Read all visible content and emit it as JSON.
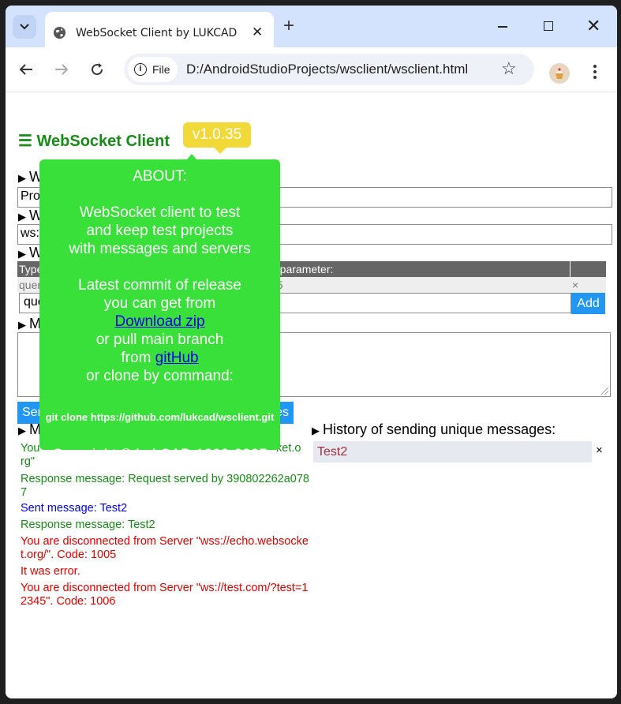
{
  "browser": {
    "tab_title": "WebSocket Client by LUKCAD",
    "chip_label": "File",
    "url": "D:/AndroidStudioProjects/wsclient/wsclient.html"
  },
  "app": {
    "menu_glyph": "☰",
    "title": "WebSocket Client",
    "version": "v1.0.35"
  },
  "sections": {
    "projects_label": "W",
    "project_value": "Pro",
    "servers_label": "W",
    "server_value": "ws:",
    "params_label": "W",
    "message_label": "M",
    "log_label": "M"
  },
  "params": {
    "head_type": "Type",
    "head_value": "e parameter:",
    "row_type": "quer",
    "row_value": "45",
    "row_remove": "×",
    "input_value": "que",
    "add_label": "Add"
  },
  "send": {
    "left_label": "Sen",
    "right_label": "es"
  },
  "log": [
    {
      "kind": "resp",
      "text": "You"
    },
    {
      "kind": "resp",
      "text": "rg\""
    },
    {
      "kind": "resp",
      "text": "Response message: Request served by 390802262a0787"
    },
    {
      "kind": "sent",
      "text": "Sent message: Test2"
    },
    {
      "kind": "resp",
      "text": "Response message: Test2"
    },
    {
      "kind": "err",
      "text": "You are disconnected from Server \"wss://echo.websocket.org/\". Code: 1005"
    },
    {
      "kind": "err",
      "text": "It was error."
    },
    {
      "kind": "err",
      "text": "You are disconnected from Server \"ws://test.com/?test=12345\". Code: 1006"
    }
  ],
  "log_partial_right": "ket.o",
  "history": {
    "title": "History of sending unique messages:",
    "items": [
      "Test2"
    ],
    "remove": "×"
  },
  "about": {
    "heading": "ABOUT:",
    "desc1": "WebSocket client to test",
    "desc2": "and keep test projects",
    "desc3": "with messages and servers",
    "latest1": "Latest commit of release",
    "latest2": "you can get from",
    "download_link": "Download zip",
    "pull": "or pull main branch",
    "from_prefix": "from ",
    "github_link": "gitHub",
    "clone": "or clone by command:",
    "command": "git clone https://github.com/lukcad/wsclient.git",
    "copyright": "Copyright © LukCAD 1992-2025"
  },
  "colors": {
    "accent_green": "#188b18",
    "popup_green": "#3ae03a",
    "version_yellow": "#f2d93a",
    "button_blue": "#2196f3",
    "error_red": "#e00000",
    "sent_blue": "#0000ee"
  }
}
